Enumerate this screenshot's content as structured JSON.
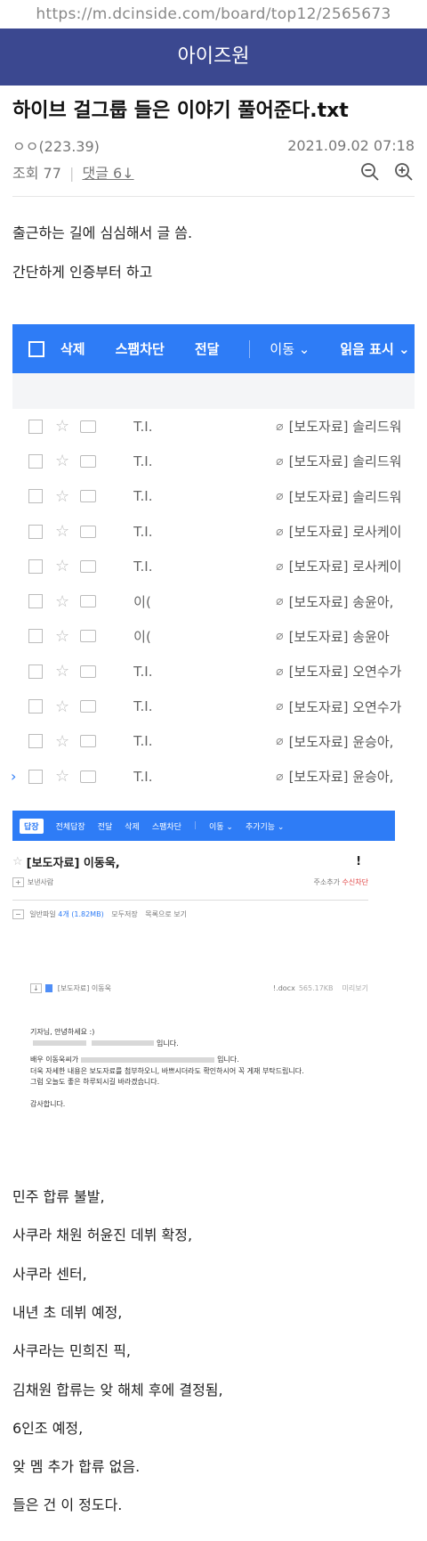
{
  "url_bar": {
    "text": "https://m.dcinside.com/board/top12/2565673"
  },
  "gallery": {
    "name": "아이즈원"
  },
  "post": {
    "title": "하이브 걸그룹 들은 이야기 풀어준다.txt",
    "author": "ㅇㅇ(223.39)",
    "datetime": "2021.09.02 07:18",
    "views": "조회 77",
    "comments": "댓글 6↓",
    "intro_lines": [
      "출근하는 길에 심심해서 글 씀.",
      "간단하게 인증부터 하고"
    ],
    "closing_lines": [
      "민주 합류 불발,",
      "사쿠라 채원 허윤진 데뷔 확정,",
      "사쿠라 센터,",
      "내년 초 데뷔 예정,",
      "사쿠라는 민희진 픽,",
      "김채원 합류는 앚 해체 후에 결정됨,",
      "6인조 예정,",
      "앚 멤 추가 합류 없음.",
      "들은 건 이 정도다."
    ]
  },
  "mail_list": {
    "toolbar": [
      "삭제",
      "스팸차단",
      "전달",
      "이동 ⌄",
      "읽음 표시 ⌄"
    ],
    "rows": [
      {
        "sender": "T.I.",
        "subject": "[보도자료] 솔리드워"
      },
      {
        "sender": "T.I.",
        "subject": "[보도자료] 솔리드워"
      },
      {
        "sender": "T.I.",
        "subject": "[보도자료] 솔리드워"
      },
      {
        "sender": "T.I.",
        "subject": "[보도자료] 로사케이"
      },
      {
        "sender": "T.I.",
        "subject": "[보도자료] 로사케이"
      },
      {
        "sender": "이(",
        "subject": "[보도자료] 송윤아,"
      },
      {
        "sender": "이(",
        "subject": "[보도자료] 송윤아"
      },
      {
        "sender": "T.I.",
        "subject": "[보도자료] 오연수가"
      },
      {
        "sender": "T.I.",
        "subject": "[보도자료] 오연수가"
      },
      {
        "sender": "T.I.",
        "subject": "[보도자료] 윤승아,"
      },
      {
        "sender": "T.I.",
        "subject": "[보도자료] 윤승아,"
      }
    ]
  },
  "mail_read": {
    "toolbar": [
      "답장",
      "전체답장",
      "전달",
      "삭제",
      "스팸차단",
      "이동 ⌄",
      "추가기능 ⌄"
    ],
    "subject": "[보도자료] 이동욱,",
    "subject_tail": "!",
    "sender_label": "보낸사람",
    "sender_actions": [
      "주소추가",
      "수신차단"
    ],
    "attach_label": "일반파일",
    "attach_count": "4개 (1.82MB)",
    "attach_actions": [
      "모두저장",
      "목록으로 보기"
    ],
    "file_name": "[보도자료] 이동욱",
    "file_ext": "!.docx",
    "file_size": "565.17KB",
    "file_action": "미리보기",
    "letter": {
      "greeting": "기자님, 안녕하세요 :)",
      "line1_end": "입니다.",
      "line2_start": "배우 이동욱씨가",
      "line2_end": "입니다.",
      "line3": "더욱 자세한 내용은 보도자료를 첨부하오니, 바쁘시더라도 확인하시어 꼭 게재 부탁드립니다.",
      "line4": "그럼 오늘도 좋은 하루되시길 바라겠습니다.",
      "thanks": "감사합니다."
    }
  },
  "colors": {
    "gallery_bar": "#3b4890",
    "mail_blue": "#2e7cf6"
  }
}
